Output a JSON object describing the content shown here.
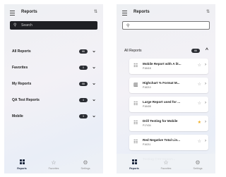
{
  "left": {
    "header": {
      "title": "Reports",
      "sort_icon": "sort-icon"
    },
    "search": {
      "placeholder": "Search"
    },
    "categories": [
      {
        "label": "All Reports",
        "count": "66"
      },
      {
        "label": "Favorites",
        "count": "0"
      },
      {
        "label": "My Reports",
        "count": "58"
      },
      {
        "label": "QA Test Reports",
        "count": "4"
      },
      {
        "label": "Mobile",
        "count": "3"
      }
    ]
  },
  "right": {
    "header": {
      "title": "Reports",
      "sort_icon": "sort-icon"
    },
    "section": {
      "label": "All Reports",
      "count": "66"
    },
    "reports": [
      {
        "name": "Mobile Report with A lit...",
        "id": "P18418",
        "icon": "table-icon",
        "favorite": false
      },
      {
        "name": "Highchart % Format M...",
        "id": "P18210",
        "icon": "bar-chart-icon",
        "favorite": false
      },
      {
        "name": "Large Report used for ...",
        "id": "P18408",
        "icon": "table-icon",
        "favorite": false
      },
      {
        "name": "Drill Testing for Mobile",
        "id": "P17434",
        "icon": "table-icon",
        "favorite": true
      },
      {
        "name": "Red Negative Total Lin...",
        "id": "P16211",
        "icon": "table-icon",
        "favorite": false
      },
      {
        "name": "Testing CSV Import...",
        "id": "",
        "icon": "table-icon",
        "favorite": false
      }
    ]
  },
  "nav": {
    "items": [
      {
        "label": "Reports",
        "icon": "reports-icon",
        "active": true
      },
      {
        "label": "Favorites",
        "icon": "star-icon",
        "active": false
      },
      {
        "label": "Settings",
        "icon": "gear-icon",
        "active": false
      }
    ]
  },
  "colors": {
    "accent": "#1f2a40",
    "favorite": "#f0ad1e",
    "badge": "#2b2d33"
  }
}
